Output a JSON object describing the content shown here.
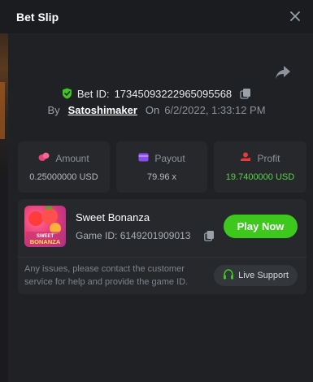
{
  "header": {
    "title": "Bet Slip"
  },
  "bet": {
    "id_label": "Bet ID:",
    "id_value": "17345093222965095568",
    "by_label": "By",
    "user": "Satoshimaker",
    "on_label": "On",
    "date": "6/2/2022, 1:33:12 PM"
  },
  "stats": {
    "amount": {
      "label": "Amount",
      "value": "0.25000000 USD"
    },
    "payout": {
      "label": "Payout",
      "value": "79.96 x"
    },
    "profit": {
      "label": "Profit",
      "value": "19.7400000 USD"
    }
  },
  "game": {
    "name": "Sweet Bonanza",
    "id_label": "Game ID:",
    "id_value": "6149201909013",
    "thumb_text_top": "SWEET",
    "thumb_text_bottom": "BONANZA",
    "play_label": "Play Now"
  },
  "support": {
    "help_text": "Any issues, please contact the customer service for help and provide the game ID.",
    "button_label": "Live Support"
  },
  "colors": {
    "accent_green": "#3ec81d",
    "profit_green": "#5ad34a",
    "amount_icon": "#e8437a",
    "payout_icon": "#8c4cf0",
    "profit_icon": "#e83a3a"
  },
  "icons": [
    "close-icon",
    "share-icon",
    "shield-check-icon",
    "copy-icon",
    "coins-icon",
    "wallet-icon",
    "profit-hand-icon",
    "headset-icon"
  ]
}
